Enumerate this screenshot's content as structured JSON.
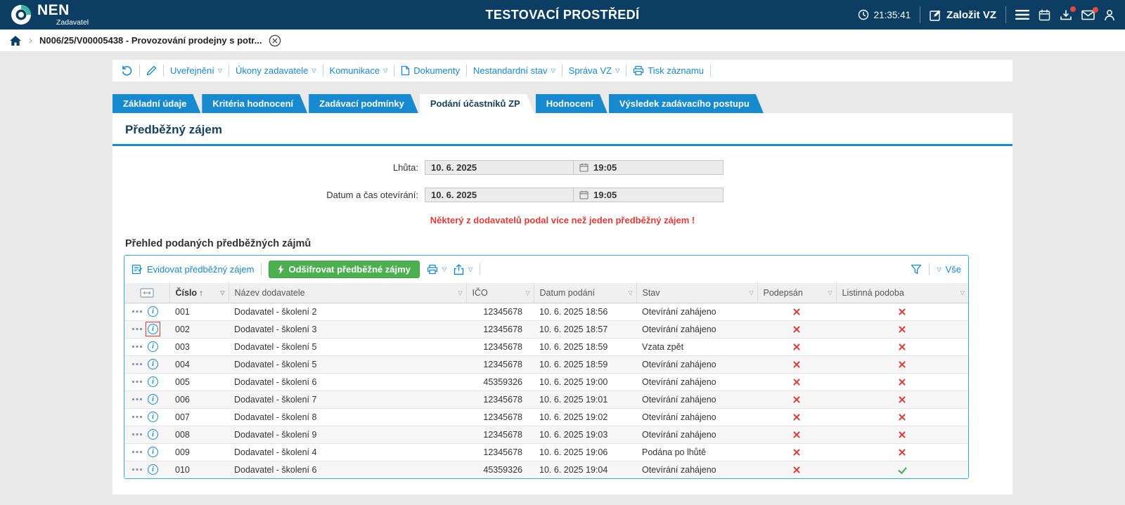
{
  "icons": {
    "caret": "▽",
    "sort_asc": "↑",
    "crumb_sep": "›"
  },
  "colors": {
    "header_bg": "#0c3e64",
    "accent_blue": "#1789ce",
    "green": "#4caf50",
    "red": "#e53935",
    "teal_logo": "#37b9a0"
  },
  "header": {
    "brand": "NEN",
    "brand_subtitle": "Zadavatel",
    "environment_title": "TESTOVACÍ PROSTŘEDÍ",
    "clock": "21:35:41",
    "create_vz_label": "Založit VZ"
  },
  "breadcrumb": {
    "record": "N006/25/V00005438 - Provozování prodejny s potr..."
  },
  "toolbar": {
    "items": [
      {
        "label": "Uveřejnění",
        "dropdown": true
      },
      {
        "label": "Úkony zadavatele",
        "dropdown": true
      },
      {
        "label": "Komunikace",
        "dropdown": true
      },
      {
        "label": "Dokumenty",
        "dropdown": false
      },
      {
        "label": "Nestandardní stav",
        "dropdown": true
      },
      {
        "label": "Správa VZ",
        "dropdown": true
      },
      {
        "label": "Tisk záznamu",
        "dropdown": false
      }
    ]
  },
  "tabs": [
    {
      "label": "Základní údaje",
      "active": false
    },
    {
      "label": "Kritéria hodnocení",
      "active": false
    },
    {
      "label": "Zadávací podmínky",
      "active": false
    },
    {
      "label": "Podání účastníků ZP",
      "active": true
    },
    {
      "label": "Hodnocení",
      "active": false
    },
    {
      "label": "Výsledek zadávacího postupu",
      "active": false
    }
  ],
  "detail": {
    "section_title": "Předběžný zájem",
    "fields": [
      {
        "label": "Lhůta:",
        "date": "10. 6. 2025",
        "time": "19:05"
      },
      {
        "label": "Datum a čas otevírání:",
        "date": "10. 6. 2025",
        "time": "19:05"
      }
    ],
    "warning": "Některý z dodavatelů podal více než jeden předběžný zájem !"
  },
  "table": {
    "title": "Přehled podaných předběžných zájmů",
    "actions": {
      "register_label": "Evidovat předběžný zájem",
      "decrypt_label": "Odšifrovat předběžné zájmy",
      "filter_all_label": "Vše"
    },
    "columns": [
      "Číslo",
      "Název dodavatele",
      "IČO",
      "Datum podání",
      "Stav",
      "Podepsán",
      "Listinná podoba"
    ],
    "sort": {
      "column": "Číslo",
      "direction": "asc"
    },
    "rows": [
      {
        "cislo": "001",
        "nazev": "Dodavatel - školení 2",
        "ico": "12345678",
        "datum": "10. 6. 2025 18:56",
        "stav": "Otevírání zahájeno",
        "podepsan": "x",
        "listinna": "x"
      },
      {
        "cislo": "002",
        "nazev": "Dodavatel - školení 3",
        "ico": "12345678",
        "datum": "10. 6. 2025 18:57",
        "stav": "Otevírání zahájeno",
        "podepsan": "x",
        "listinna": "x",
        "highlighted": true
      },
      {
        "cislo": "003",
        "nazev": "Dodavatel - školení 5",
        "ico": "12345678",
        "datum": "10. 6. 2025 18:59",
        "stav": "Vzata zpět",
        "podepsan": "x",
        "listinna": "x"
      },
      {
        "cislo": "004",
        "nazev": "Dodavatel - školení 5",
        "ico": "12345678",
        "datum": "10. 6. 2025 18:59",
        "stav": "Otevírání zahájeno",
        "podepsan": "x",
        "listinna": "x"
      },
      {
        "cislo": "005",
        "nazev": "Dodavatel - školení 6",
        "ico": "45359326",
        "datum": "10. 6. 2025 19:00",
        "stav": "Otevírání zahájeno",
        "podepsan": "x",
        "listinna": "x"
      },
      {
        "cislo": "006",
        "nazev": "Dodavatel - školení 7",
        "ico": "12345678",
        "datum": "10. 6. 2025 19:01",
        "stav": "Otevírání zahájeno",
        "podepsan": "x",
        "listinna": "x"
      },
      {
        "cislo": "007",
        "nazev": "Dodavatel - školení 8",
        "ico": "12345678",
        "datum": "10. 6. 2025 19:02",
        "stav": "Otevírání zahájeno",
        "podepsan": "x",
        "listinna": "x"
      },
      {
        "cislo": "008",
        "nazev": "Dodavatel - školení 9",
        "ico": "12345678",
        "datum": "10. 6. 2025 19:03",
        "stav": "Otevírání zahájeno",
        "podepsan": "x",
        "listinna": "x"
      },
      {
        "cislo": "009",
        "nazev": "Dodavatel - školení 4",
        "ico": "12345678",
        "datum": "10. 6. 2025 19:06",
        "stav": "Podána po lhůtě",
        "podepsan": "x",
        "listinna": "x"
      },
      {
        "cislo": "010",
        "nazev": "Dodavatel - školení 6",
        "ico": "45359326",
        "datum": "10. 6. 2025 19:04",
        "stav": "Otevírání zahájeno",
        "podepsan": "x",
        "listinna": "check"
      }
    ]
  }
}
